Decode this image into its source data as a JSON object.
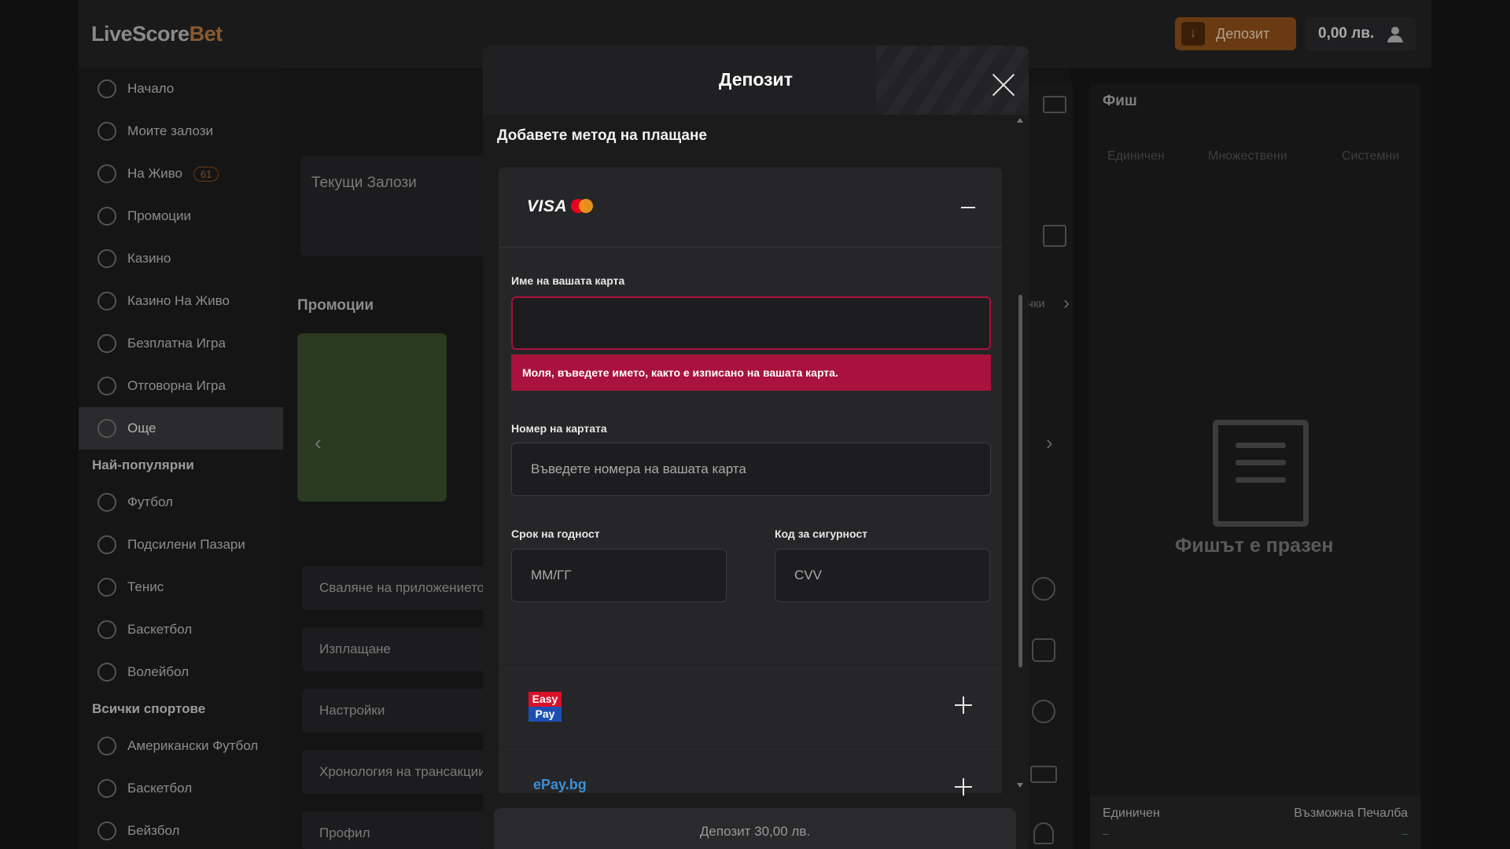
{
  "header": {
    "logo_main": "LiveScore",
    "logo_accent": "Bet",
    "deposit_label": "Депозит",
    "balance": "0,00 лв."
  },
  "sidebar": {
    "items": [
      {
        "label": "Начало",
        "icon": "home-icon"
      },
      {
        "label": "Моите залози",
        "icon": "bets-icon"
      },
      {
        "label": "На Живо",
        "icon": "live-icon",
        "badge": "61"
      },
      {
        "label": "Промоции",
        "icon": "tag-icon"
      },
      {
        "label": "Казино",
        "icon": "casino-icon"
      },
      {
        "label": "Казино На Живо",
        "icon": "live-casino-icon"
      },
      {
        "label": "Безплатна Игра",
        "icon": "free-game-icon"
      },
      {
        "label": "Отговорна Игра",
        "icon": "shield-icon"
      },
      {
        "label": "Още",
        "icon": "more-icon",
        "active": true
      }
    ],
    "popular_title": "Най-популярни",
    "popular": [
      {
        "label": "Футбол"
      },
      {
        "label": "Подсилени Пазари"
      },
      {
        "label": "Тенис"
      },
      {
        "label": "Баскетбол"
      },
      {
        "label": "Волейбол"
      }
    ],
    "all_sports_title": "Всички спортове",
    "all_sports": [
      {
        "label": "Американски Футбол"
      },
      {
        "label": "Баскетбол"
      },
      {
        "label": "Бейзбол"
      }
    ]
  },
  "main": {
    "current_bets": "Текущи Залози",
    "promotions": "Промоции",
    "menu": [
      "Сваляне на приложението",
      "Изплащане",
      "Настройки",
      "Хронология на трансакциите",
      "Профил"
    ],
    "promo_more": "чки"
  },
  "slip": {
    "title": "Фиш",
    "tabs": [
      "Единичен",
      "Множествени",
      "Системни"
    ],
    "empty": "Фишът е празен",
    "bottom_left": "Единичен",
    "bottom_right": "Възможна Печалба",
    "bottom_left_value": "–",
    "bottom_right_value": "–"
  },
  "modal": {
    "title": "Депозит",
    "section_title": "Добавете метод на плащане",
    "visa_label": "VISA",
    "card_name_label": "Име на вашата карта",
    "card_name_value": "",
    "card_name_error": "Моля, въведете името, както е изписано на вашата карта.",
    "card_number_label": "Номер на картата",
    "card_number_placeholder": "Въведете номера на вашата карта",
    "expiry_label": "Срок на годност",
    "expiry_placeholder": "ММ/ГГ",
    "cvv_label": "Код за сигурност",
    "cvv_placeholder": "CVV",
    "easypay_top": "Easy",
    "easypay_bottom": "Pay",
    "epay_label": "ePay.bg",
    "footer_button": "Депозит 30,00 лв."
  },
  "colors": {
    "accent": "#f07c1a",
    "error": "#a8123c",
    "modal_bg": "#1b1b1c"
  }
}
